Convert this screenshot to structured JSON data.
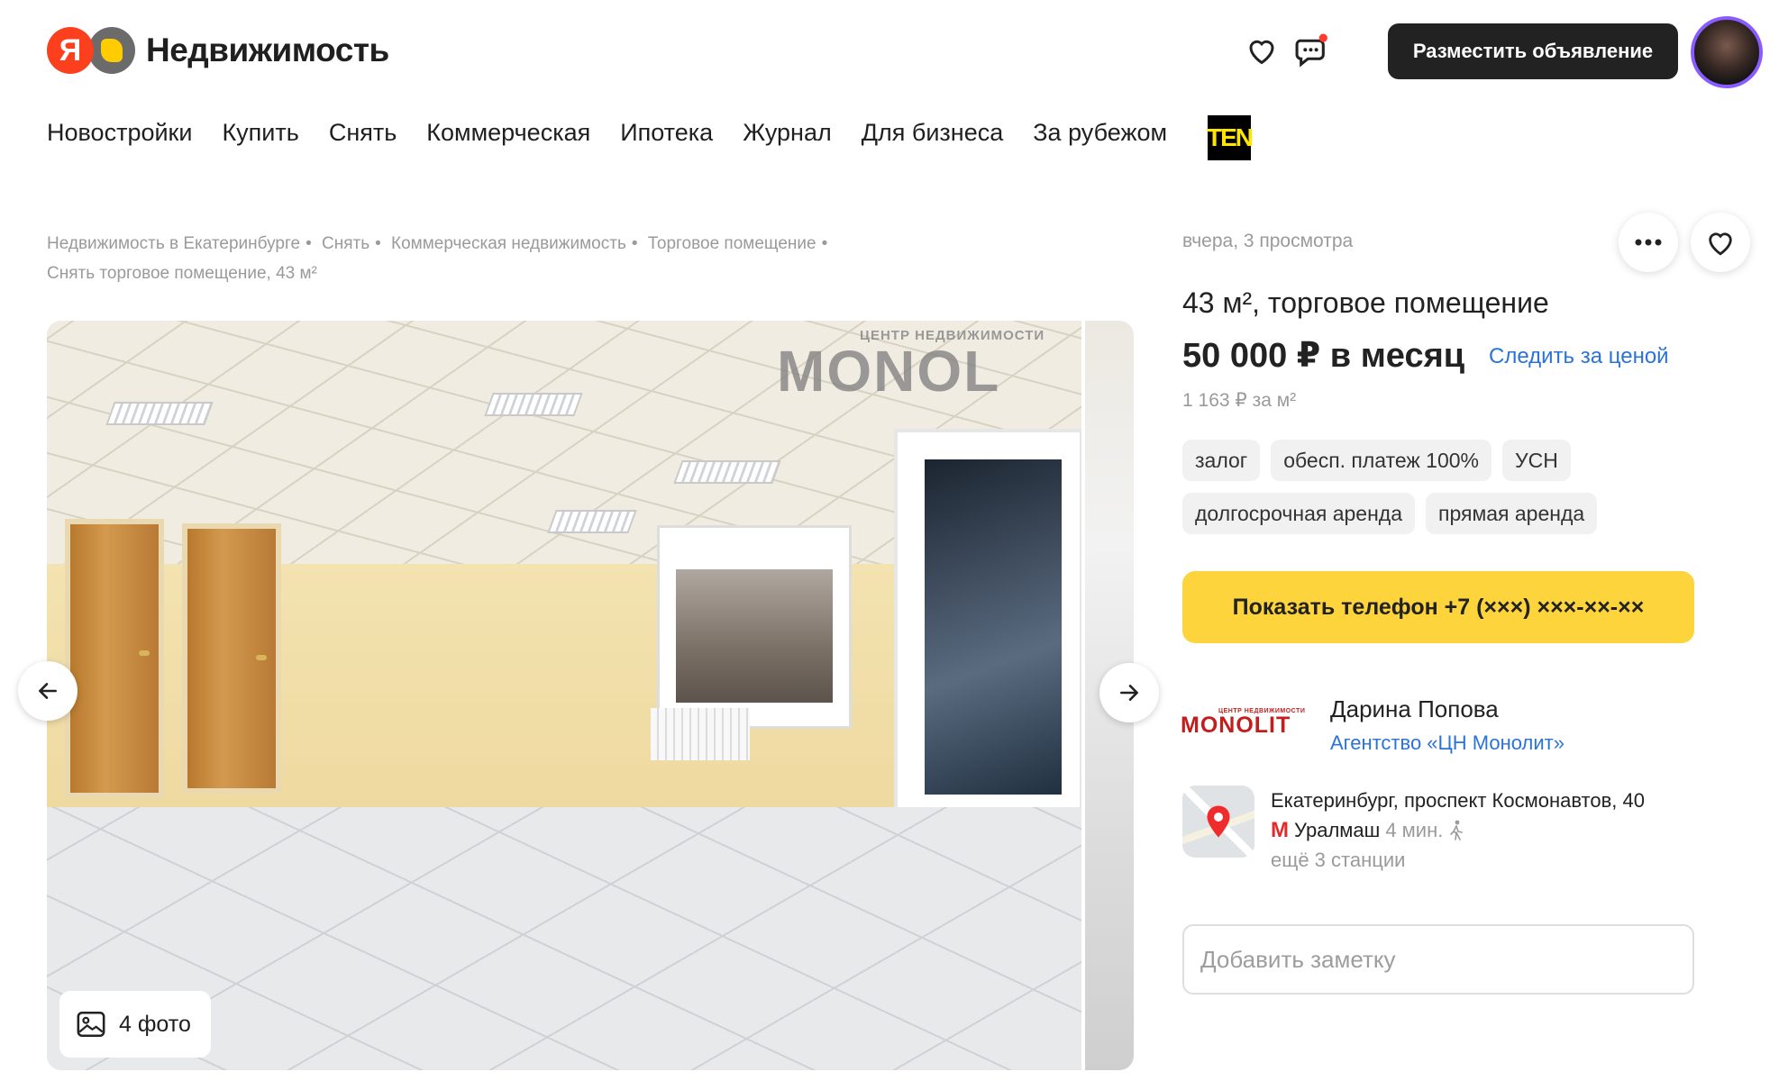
{
  "header": {
    "logo_letter": "Я",
    "logo_text": "Недвижимость",
    "post_button": "Разместить объявление",
    "icons": [
      "heart-icon",
      "chat-icon",
      "avatar"
    ]
  },
  "nav": {
    "items": [
      "Новостройки",
      "Купить",
      "Снять",
      "Коммерческая",
      "Ипотека",
      "Журнал",
      "Для бизнеса",
      "За рубежом"
    ],
    "ten_label": "TEN"
  },
  "breadcrumbs": [
    "Недвижимость в Екатеринбурге",
    "Снять",
    "Коммерческая недвижимость",
    "Торговое помещение",
    "Снять торговое помещение, 43 м²"
  ],
  "gallery": {
    "photo_count": "4 фото",
    "watermark_small": "ЦЕНТР НЕДВИЖИМОСТИ",
    "watermark_big": "MONOL"
  },
  "listing": {
    "meta": "вчера, 3 просмотра",
    "title": "43 м², торговое помещение",
    "price": "50 000 ₽ в месяц",
    "follow_price": "Следить за ценой",
    "price_per_m2": "1 163 ₽ за м²",
    "tags": [
      "залог",
      "обесп. платеж 100%",
      "УСН",
      "долгосрочная аренда",
      "прямая аренда"
    ],
    "phone_button": "Показать телефон +7 (×××) ×××-××-××"
  },
  "agent": {
    "logo_small": "ЦЕНТР НЕДВИЖИМОСТИ",
    "logo_big": "MONOLIT",
    "name": "Дарина Попова",
    "agency": "Агентство «ЦН Монолит»"
  },
  "location": {
    "address": "Екатеринбург, проспект Космонавтов, 40",
    "metro_station": "Уралмаш",
    "metro_time": "4 мин.",
    "more_stations": "ещё 3 станции"
  },
  "note": {
    "placeholder": "Добавить заметку"
  },
  "colors": {
    "accent_yellow": "#fdd43b",
    "link_blue": "#2a73d9",
    "brand_red": "#fc3f1d",
    "dark_button": "#222222"
  }
}
